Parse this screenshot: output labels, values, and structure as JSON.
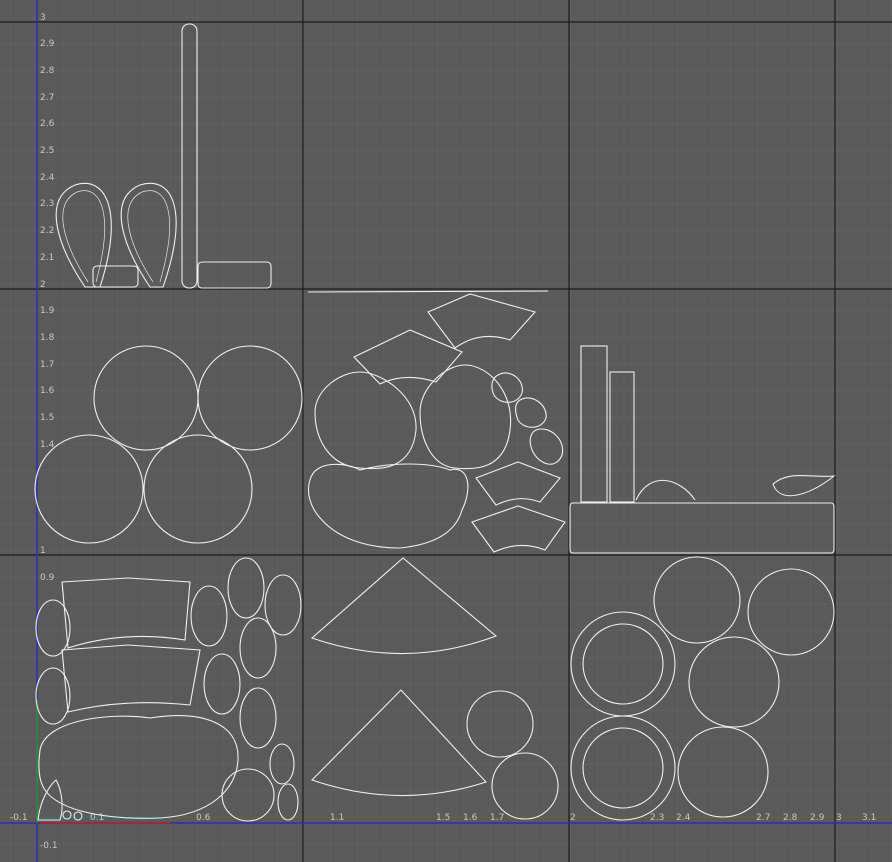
{
  "viewport": {
    "background": "#5a5a5a",
    "grid_minor_color": "#656565",
    "grid_major_color": "#1a1a1a",
    "wire_color": "#efefef",
    "u_axis_color": "#2a2ad0",
    "v_axis_color": "#2a2ad0"
  },
  "u_labels": [
    "-0.1",
    "0.1",
    "0.6",
    "1.1",
    "1.5",
    "1.6",
    "1.7",
    "2",
    "2.3",
    "2.4",
    "2.7",
    "2.8",
    "2.9",
    "3",
    "3.1"
  ],
  "v_labels": [
    "3",
    "2.9",
    "2.8",
    "2.7",
    "2.6",
    "2.5",
    "2.4",
    "2.3",
    "2.2",
    "2.1",
    "2",
    "1.9",
    "1.8",
    "1.7",
    "1.6",
    "1.5",
    "1.4",
    "1",
    "0.9",
    "-0.1"
  ],
  "uv_tiles": [
    "tile-0-0",
    "tile-1-0",
    "tile-2-0",
    "tile-0-1",
    "tile-1-1",
    "tile-2-1",
    "tile-0-2",
    "tile-1-2",
    "tile-2-2"
  ]
}
